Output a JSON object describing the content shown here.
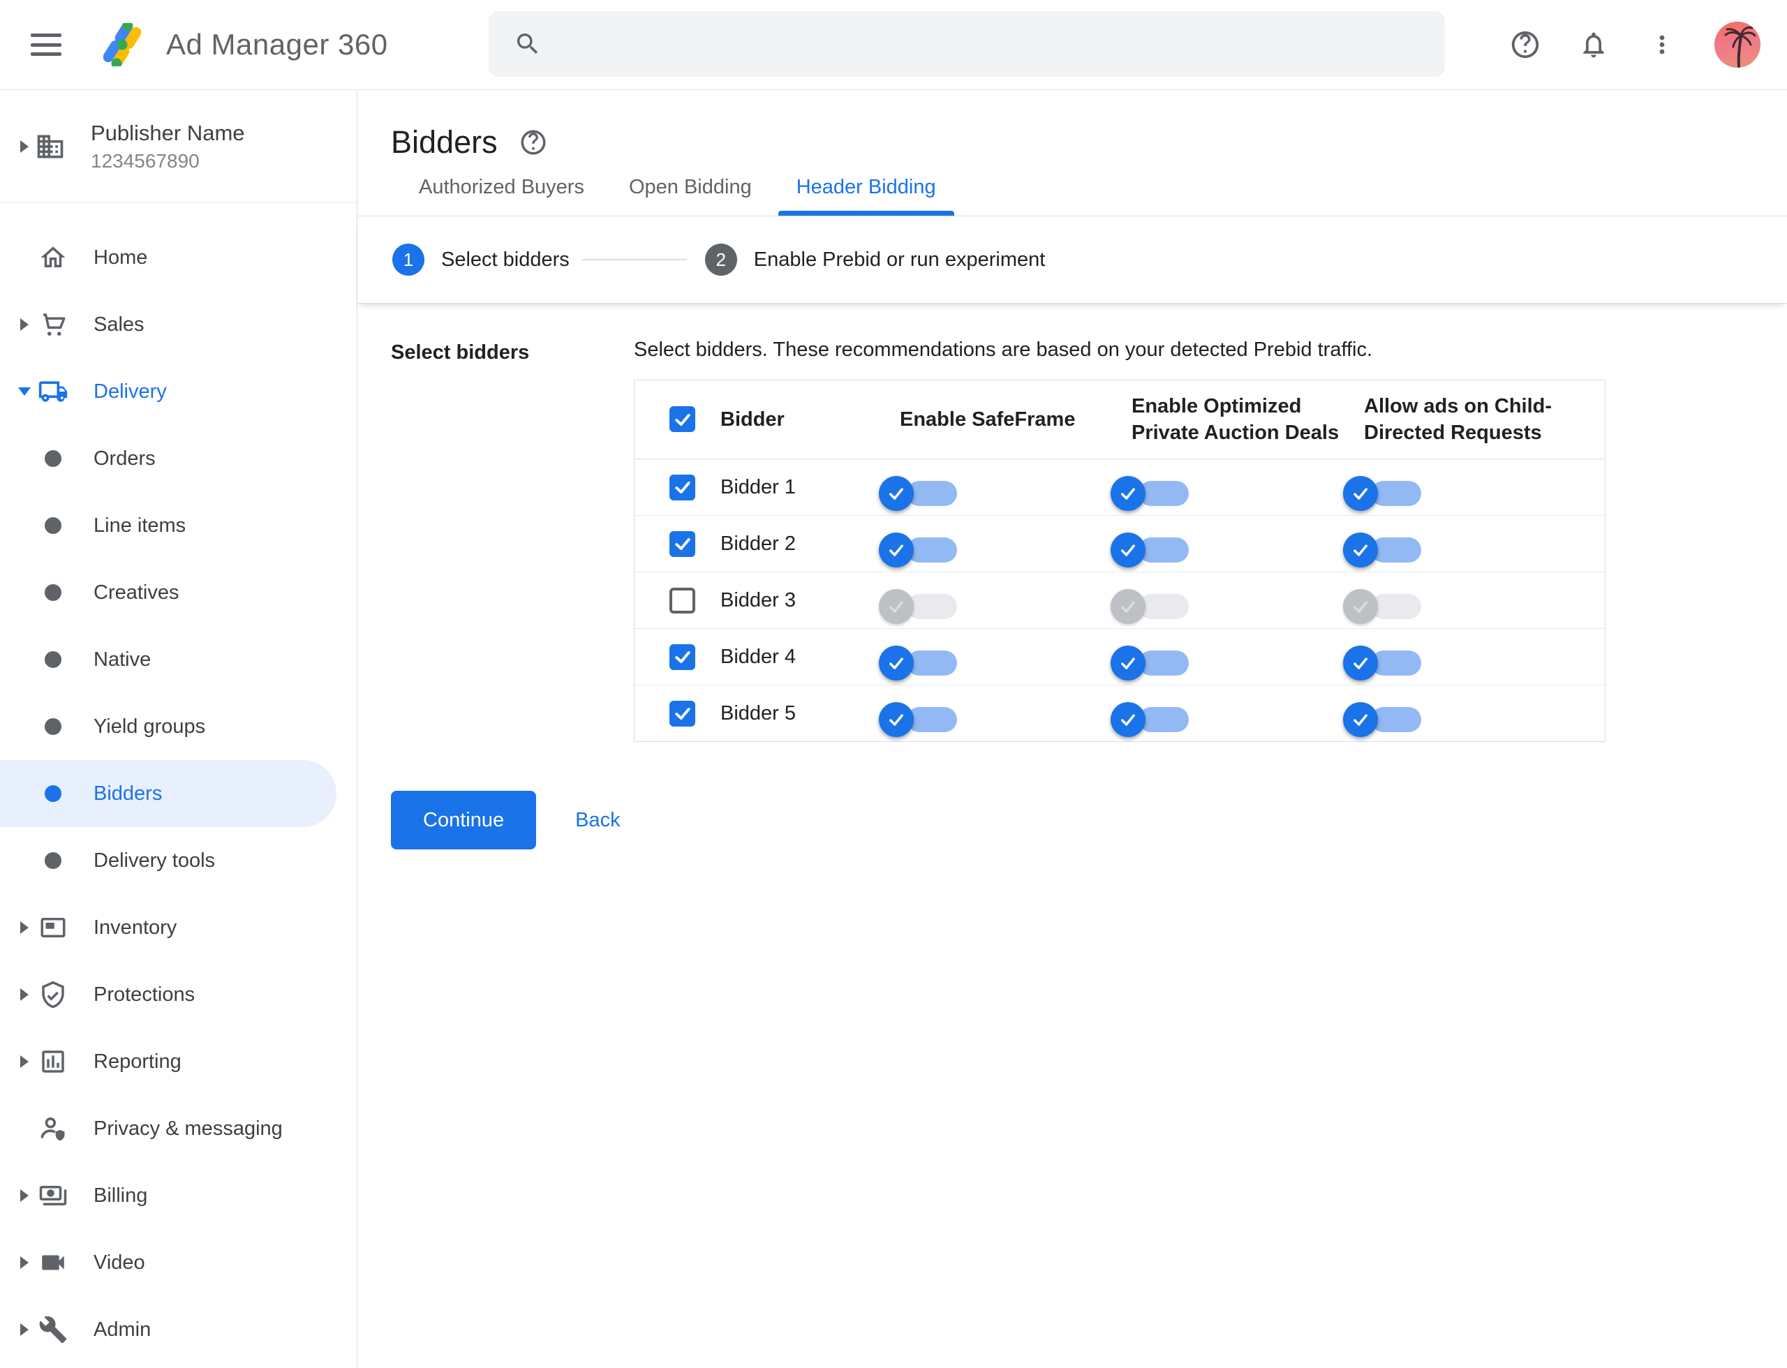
{
  "header": {
    "product_name": "Ad Manager 360",
    "search_placeholder": "",
    "icons": {
      "menu": "hamburger-icon",
      "search": "magnifier-icon",
      "help": "question-circle-icon",
      "notifications": "bell-icon",
      "more": "kebab-menu-icon",
      "avatar": "palm-tree-sunset-photo"
    }
  },
  "publisher": {
    "name": "Publisher Name",
    "id": "1234567890"
  },
  "sidebar": {
    "items": [
      {
        "label": "Home",
        "level": "top",
        "icon": "home",
        "arrow": "none",
        "active": false
      },
      {
        "label": "Sales",
        "level": "top",
        "icon": "cart",
        "arrow": "collapsed",
        "active": false
      },
      {
        "label": "Delivery",
        "level": "top",
        "icon": "truck",
        "arrow": "expanded",
        "active": true
      },
      {
        "label": "Orders",
        "level": "sub",
        "icon": "bullet",
        "arrow": "none",
        "active": false
      },
      {
        "label": "Line items",
        "level": "sub",
        "icon": "bullet",
        "arrow": "none",
        "active": false
      },
      {
        "label": "Creatives",
        "level": "sub",
        "icon": "bullet",
        "arrow": "none",
        "active": false
      },
      {
        "label": "Native",
        "level": "sub",
        "icon": "bullet",
        "arrow": "none",
        "active": false
      },
      {
        "label": "Yield groups",
        "level": "sub",
        "icon": "bullet",
        "arrow": "none",
        "active": false
      },
      {
        "label": "Bidders",
        "level": "sub",
        "icon": "bullet",
        "arrow": "none",
        "active": true,
        "selected": true
      },
      {
        "label": "Delivery tools",
        "level": "sub",
        "icon": "bullet",
        "arrow": "none",
        "active": false
      },
      {
        "label": "Inventory",
        "level": "top",
        "icon": "inventory",
        "arrow": "collapsed",
        "active": false
      },
      {
        "label": "Protections",
        "level": "top",
        "icon": "shield-check",
        "arrow": "collapsed",
        "active": false
      },
      {
        "label": "Reporting",
        "level": "top",
        "icon": "bar-chart",
        "arrow": "collapsed",
        "active": false
      },
      {
        "label": "Privacy & messaging",
        "level": "top",
        "icon": "person-shield",
        "arrow": "none",
        "active": false
      },
      {
        "label": "Billing",
        "level": "top",
        "icon": "money",
        "arrow": "collapsed",
        "active": false
      },
      {
        "label": "Video",
        "level": "top",
        "icon": "video-camera",
        "arrow": "collapsed",
        "active": false
      },
      {
        "label": "Admin",
        "level": "top",
        "icon": "wrench",
        "arrow": "collapsed",
        "active": false
      }
    ]
  },
  "page": {
    "title": "Bidders",
    "tabs": [
      {
        "label": "Authorized Buyers",
        "active": false
      },
      {
        "label": "Open Bidding",
        "active": false
      },
      {
        "label": "Header Bidding",
        "active": true
      }
    ],
    "steps": [
      {
        "number": "1",
        "label": "Select bidders",
        "state": "current"
      },
      {
        "number": "2",
        "label": "Enable Prebid or run experiment",
        "state": "upcoming"
      }
    ],
    "section_label": "Select bidders",
    "description": "Select bidders. These recommendations are based on your detected Prebid traffic.",
    "table": {
      "select_all_checked": true,
      "columns": [
        "Bidder",
        "Enable SafeFrame",
        "Enable Optimized Private Auction Deals",
        "Allow ads on Child-Directed Requests"
      ],
      "rows": [
        {
          "name": "Bidder 1",
          "checked": true,
          "safeframe": true,
          "optimized_deals": true,
          "child_directed": true,
          "toggles_disabled": false
        },
        {
          "name": "Bidder 2",
          "checked": true,
          "safeframe": true,
          "optimized_deals": true,
          "child_directed": true,
          "toggles_disabled": false
        },
        {
          "name": "Bidder 3",
          "checked": false,
          "safeframe": true,
          "optimized_deals": true,
          "child_directed": true,
          "toggles_disabled": true
        },
        {
          "name": "Bidder 4",
          "checked": true,
          "safeframe": true,
          "optimized_deals": true,
          "child_directed": true,
          "toggles_disabled": false
        },
        {
          "name": "Bidder 5",
          "checked": true,
          "safeframe": true,
          "optimized_deals": true,
          "child_directed": true,
          "toggles_disabled": false
        }
      ]
    },
    "actions": {
      "continue_label": "Continue",
      "back_label": "Back"
    }
  },
  "colors": {
    "accent": "#1a73e8",
    "toggle_track_on": "#93b9f4",
    "selected_item_bg": "#e8f0fe",
    "text_primary": "#202124",
    "text_secondary": "#5f6368",
    "border": "#dadce0",
    "disabled_track": "#e9eaed",
    "disabled_thumb": "#bdc1c6",
    "search_bg": "#f1f3f4",
    "step_upcoming": "#5f6368"
  }
}
